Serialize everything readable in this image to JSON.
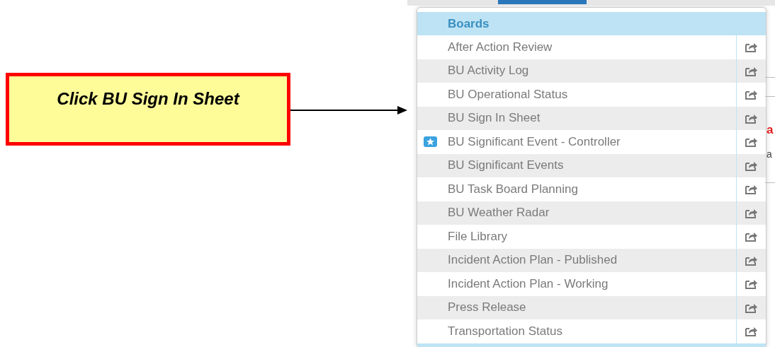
{
  "callout": {
    "text": "Click BU Sign In Sheet"
  },
  "menu": {
    "header": "Boards",
    "items": [
      {
        "label": "After Action Review",
        "starred": false
      },
      {
        "label": "BU Activity Log",
        "starred": false
      },
      {
        "label": "BU Operational Status",
        "starred": false
      },
      {
        "label": "BU Sign In Sheet",
        "starred": false
      },
      {
        "label": "BU Significant Event - Controller",
        "starred": true
      },
      {
        "label": "BU Significant Events",
        "starred": false
      },
      {
        "label": "BU Task Board Planning",
        "starred": false
      },
      {
        "label": "BU Weather Radar",
        "starred": false
      },
      {
        "label": "File Library",
        "starred": false
      },
      {
        "label": "Incident Action Plan - Published",
        "starred": false
      },
      {
        "label": "Incident Action Plan - Working",
        "starred": false
      },
      {
        "label": "Press Release",
        "starred": false
      },
      {
        "label": "Transportation Status",
        "starred": false
      }
    ]
  },
  "background_fragments": [
    {
      "text": "a",
      "kind": "alert"
    },
    {
      "text": "a",
      "kind": "plain"
    }
  ]
}
